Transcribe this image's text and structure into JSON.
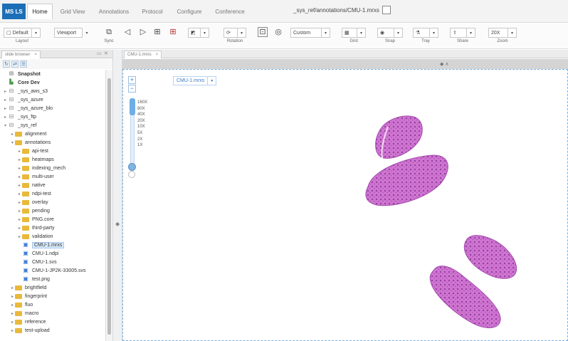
{
  "app": {
    "logo": "MS LS",
    "title": "_sys_ref/annotations/CMU-1.mrxs"
  },
  "menu": {
    "items": [
      "Home",
      "Grid View",
      "Annotations",
      "Protocol",
      "Configure",
      "Conference"
    ],
    "active": "Home"
  },
  "toolbar": {
    "layout_value": "Default",
    "layout_caption": "Layout",
    "viewport_value": "Viewport",
    "sync_caption": "Sync",
    "rotation_caption": "Rotation",
    "custom_value": "Custom",
    "grid_caption": "Grid",
    "snap_caption": "Snap",
    "tray_caption": "Tray",
    "share_caption": "Share",
    "zoom_value": "20X",
    "zoom_caption": "Zoom"
  },
  "panel": {
    "tab_label": "slide browser",
    "tab_close": "×",
    "tree": [
      {
        "label": "Snapshot",
        "depth": 0,
        "arrow": "",
        "icon": "snap",
        "bold": true
      },
      {
        "label": "Core Dev",
        "depth": 0,
        "arrow": "",
        "icon": "core",
        "bold": true
      },
      {
        "label": "_sys_aws_s3",
        "depth": 0,
        "arrow": "▸",
        "icon": "db"
      },
      {
        "label": "_sys_azure",
        "depth": 0,
        "arrow": "▸",
        "icon": "db"
      },
      {
        "label": "_sys_azure_blo",
        "depth": 0,
        "arrow": "▸",
        "icon": "db"
      },
      {
        "label": "_sys_ftp",
        "depth": 0,
        "arrow": "▸",
        "icon": "db"
      },
      {
        "label": "_sys_ref",
        "depth": 0,
        "arrow": "▾",
        "icon": "db"
      },
      {
        "label": "alignment",
        "depth": 1,
        "arrow": "▸",
        "icon": "folder"
      },
      {
        "label": "annotations",
        "depth": 1,
        "arrow": "▾",
        "icon": "folder"
      },
      {
        "label": "api-test",
        "depth": 2,
        "arrow": "▸",
        "icon": "folder"
      },
      {
        "label": "heatmaps",
        "depth": 2,
        "arrow": "▸",
        "icon": "folder"
      },
      {
        "label": "indexing_mech",
        "depth": 2,
        "arrow": "▸",
        "icon": "folder"
      },
      {
        "label": "multi-user",
        "depth": 2,
        "arrow": "▸",
        "icon": "folder"
      },
      {
        "label": "native",
        "depth": 2,
        "arrow": "▸",
        "icon": "folder"
      },
      {
        "label": "ndpi-test",
        "depth": 2,
        "arrow": "▸",
        "icon": "folder"
      },
      {
        "label": "overlay",
        "depth": 2,
        "arrow": "▸",
        "icon": "folder"
      },
      {
        "label": "pending",
        "depth": 2,
        "arrow": "▸",
        "icon": "folder"
      },
      {
        "label": "PNG.core",
        "depth": 2,
        "arrow": "▸",
        "icon": "folder"
      },
      {
        "label": "third-party",
        "depth": 2,
        "arrow": "▸",
        "icon": "folder"
      },
      {
        "label": "validation",
        "depth": 2,
        "arrow": "▸",
        "icon": "folder"
      },
      {
        "label": "CMU-1.mrxs",
        "depth": 2,
        "arrow": "",
        "icon": "file",
        "selected": true
      },
      {
        "label": "CMU-1.ndpi",
        "depth": 2,
        "arrow": "",
        "icon": "file"
      },
      {
        "label": "CMU-1.svs",
        "depth": 2,
        "arrow": "",
        "icon": "file"
      },
      {
        "label": "CMU-1-JP2K-33005.svs",
        "depth": 2,
        "arrow": "",
        "icon": "file"
      },
      {
        "label": "test.png",
        "depth": 2,
        "arrow": "",
        "icon": "file"
      },
      {
        "label": "brightfield",
        "depth": 1,
        "arrow": "▸",
        "icon": "folder"
      },
      {
        "label": "fingerprint",
        "depth": 1,
        "arrow": "▸",
        "icon": "folder"
      },
      {
        "label": "fluo",
        "depth": 1,
        "arrow": "▸",
        "icon": "folder"
      },
      {
        "label": "macro",
        "depth": 1,
        "arrow": "▸",
        "icon": "folder"
      },
      {
        "label": "reference",
        "depth": 1,
        "arrow": "▸",
        "icon": "folder"
      },
      {
        "label": "test-upload",
        "depth": 1,
        "arrow": "▸",
        "icon": "folder"
      }
    ]
  },
  "viewer": {
    "tab_label": "CMU-1.mrxs",
    "tab_close": "×",
    "slide_select_value": "CMU-1.mrxs",
    "zoom_in": "+",
    "zoom_out": "−",
    "zoom_levels": [
      "160X",
      "80X",
      "40X",
      "20X",
      "10X",
      "5X",
      "2X",
      "1X"
    ],
    "zoom_slider_level": "20X"
  },
  "colors": {
    "accent": "#1c6fb6",
    "tissue_fill": "#c563c8",
    "tissue_edge": "#9a3fa6",
    "folder": "#e8b93a"
  }
}
